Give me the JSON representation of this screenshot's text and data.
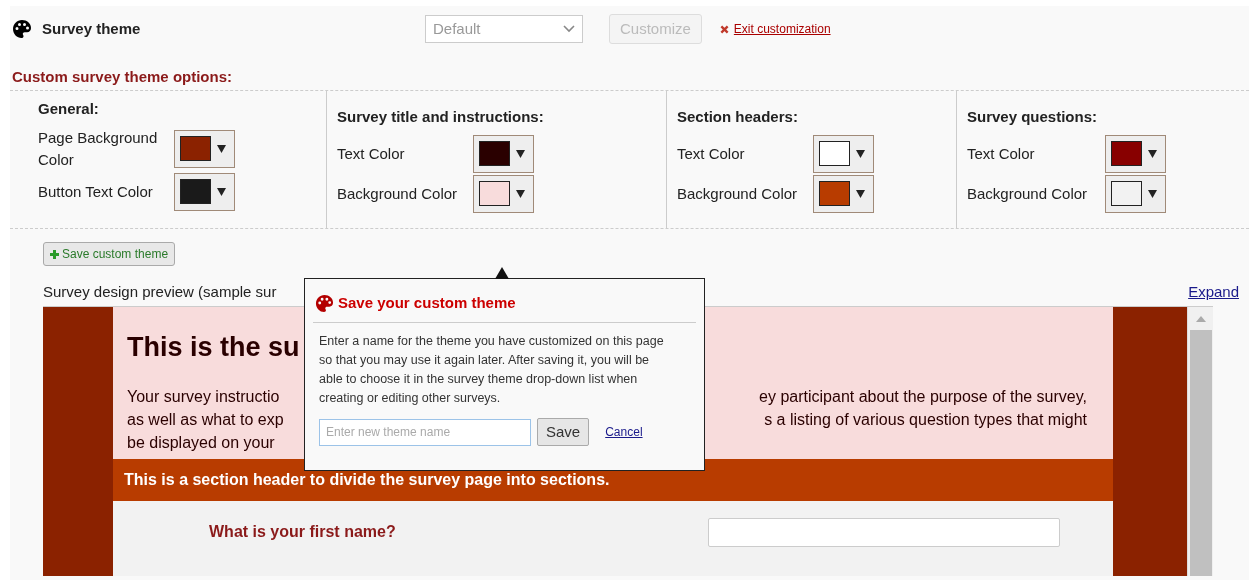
{
  "header": {
    "title": "Survey theme",
    "theme_select": {
      "value": "Default",
      "disabled": true
    },
    "customize_button": {
      "label": "Customize",
      "disabled": true
    },
    "exit_link": "Exit customization"
  },
  "options_title": "Custom survey theme options:",
  "groups": [
    {
      "title": "General:",
      "fields": [
        {
          "label": "Page Background Color",
          "color": "#8b2200"
        },
        {
          "label": "Button Text Color",
          "color": "#1a1a1a"
        }
      ]
    },
    {
      "title": "Survey title and instructions:",
      "fields": [
        {
          "label": "Text Color",
          "color": "#2a0000"
        },
        {
          "label": "Background Color",
          "color": "#f8dcdc"
        }
      ]
    },
    {
      "title": "Section headers:",
      "fields": [
        {
          "label": "Text Color",
          "color": "#ffffff"
        },
        {
          "label": "Background Color",
          "color": "#b83c00"
        }
      ]
    },
    {
      "title": "Survey questions:",
      "fields": [
        {
          "label": "Text Color",
          "color": "#880000"
        },
        {
          "label": "Background Color",
          "color": "#f2f2f2"
        }
      ]
    }
  ],
  "save_button": "Save custom theme",
  "preview": {
    "label": "Survey design preview (sample sur",
    "expand": "Expand",
    "title": "This is the su",
    "instruction_lines": [
      {
        "left": "Your survey instructio",
        "right": "ey participant about the purpose of the survey,"
      },
      {
        "left": "as well as what to exp",
        "right": "s a listing of various question types that might"
      },
      {
        "left": "be displayed on your"
      }
    ],
    "section_header": "This is a section header to divide the survey page into sections.",
    "question": "What is your first name?"
  },
  "popover": {
    "title": "Save your custom theme",
    "text": "Enter a name for the theme you have customized on this page so that you may use it again later. After saving it, you will be able to choose it in the survey theme drop-down list when creating or editing other surveys.",
    "placeholder": "Enter new theme name",
    "save": "Save",
    "cancel": "Cancel"
  }
}
